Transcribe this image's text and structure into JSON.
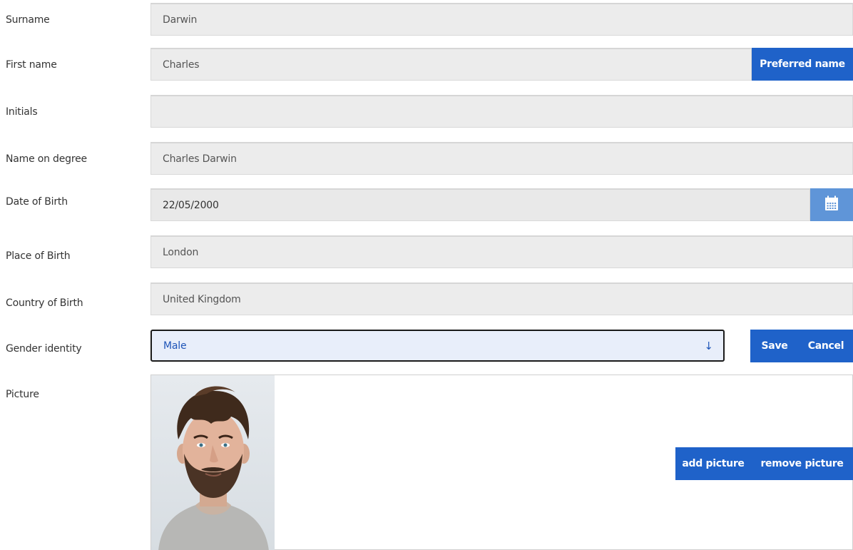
{
  "fields": {
    "surname": {
      "label": "Surname",
      "value": "Darwin"
    },
    "first_name": {
      "label": "First name",
      "value": "Charles"
    },
    "initials": {
      "label": "Initials",
      "value": ""
    },
    "name_on_degree": {
      "label": "Name on degree",
      "value": "Charles Darwin"
    },
    "date_of_birth": {
      "label": "Date of Birth",
      "value": "22/05/2000"
    },
    "place_of_birth": {
      "label": "Place of Birth",
      "value": "London"
    },
    "country_of_birth": {
      "label": "Country of Birth",
      "value": "United Kingdom"
    },
    "gender_identity": {
      "label": "Gender identity",
      "value": "Male"
    },
    "picture": {
      "label": "Picture"
    }
  },
  "buttons": {
    "preferred_name": "Preferred name",
    "save": "Save",
    "cancel": "Cancel",
    "add_picture": "add picture",
    "remove_picture": "remove picture"
  },
  "icons": {
    "calendar": "calendar-icon",
    "dropdown_arrow": "↓"
  },
  "colors": {
    "primary_button": "#1f62c9",
    "calendar_button": "#5f95d8",
    "field_background": "#ececec",
    "select_background": "#e8eefa",
    "select_text": "#1f55b8"
  }
}
